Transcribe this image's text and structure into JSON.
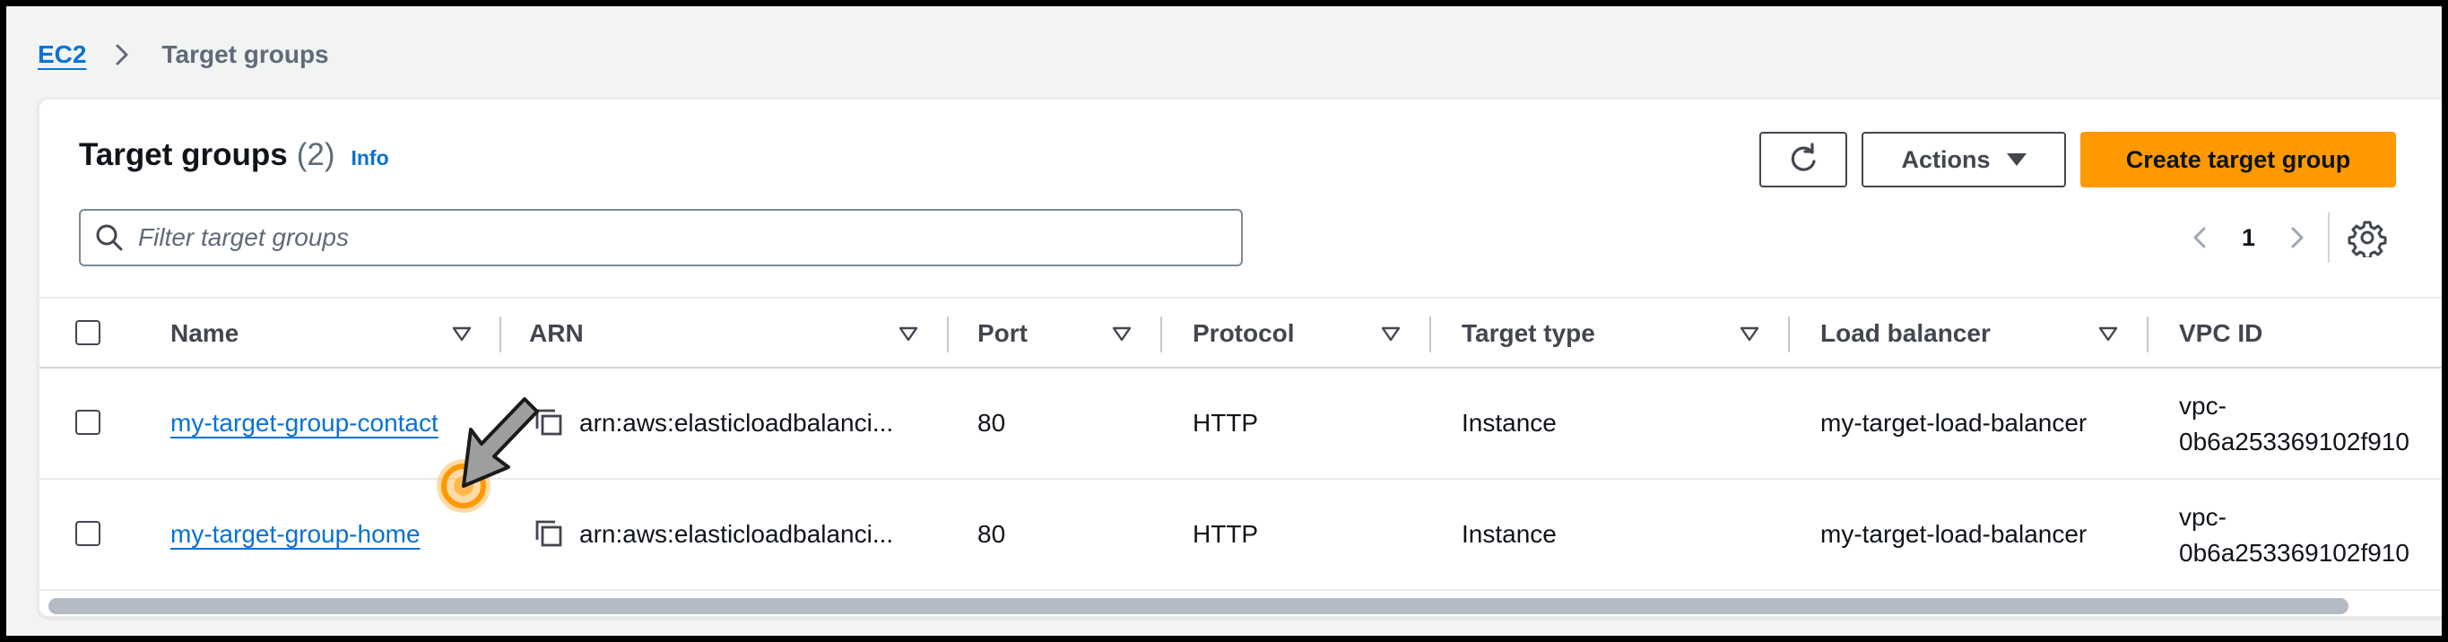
{
  "breadcrumb": {
    "root": "EC2",
    "current": "Target groups"
  },
  "header": {
    "title": "Target groups",
    "count": "(2)",
    "info_label": "Info"
  },
  "toolbar": {
    "refresh_icon": "refresh-icon",
    "actions_label": "Actions",
    "create_label": "Create target group"
  },
  "search": {
    "placeholder": "Filter target groups",
    "value": ""
  },
  "pagination": {
    "current_page": "1"
  },
  "table": {
    "columns": [
      "Name",
      "ARN",
      "Port",
      "Protocol",
      "Target type",
      "Load balancer",
      "VPC ID"
    ],
    "rows": [
      {
        "name": "my-target-group-contact",
        "arn": "arn:aws:elasticloadbalanci...",
        "port": "80",
        "protocol": "HTTP",
        "target_type": "Instance",
        "load_balancer": "my-target-load-balancer",
        "vpc_line1": "vpc-",
        "vpc_line2": "0b6a253369102f910"
      },
      {
        "name": "my-target-group-home",
        "arn": "arn:aws:elasticloadbalanci...",
        "port": "80",
        "protocol": "HTTP",
        "target_type": "Instance",
        "load_balancer": "my-target-load-balancer",
        "vpc_line1": "vpc-",
        "vpc_line2": "0b6a253369102f910"
      }
    ]
  },
  "colors": {
    "accent": "#0972d3",
    "primary_button": "#ff9900",
    "cursor_highlight": "#ff9900"
  }
}
